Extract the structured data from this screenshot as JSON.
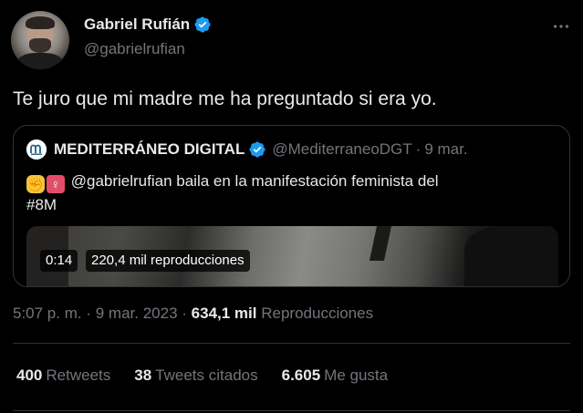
{
  "author": {
    "name": "Gabriel Rufián",
    "handle": "@gabrielrufian",
    "verified_color": "#1d9bf0"
  },
  "tweet": {
    "text": "Te juro que mi madre me ha preguntado si era yo."
  },
  "quoted": {
    "name": "MEDITERRÁNEO DIGITAL",
    "handle": "@MediterraneoDGT",
    "separator": "·",
    "date": "9 mar.",
    "emoji_1": "fist-emoji",
    "emoji_2": "female-sign-emoji",
    "text_line1": "@gabrielrufian baila en la manifestación feminista del",
    "text_line2": "#8M",
    "video_time": "0:14",
    "video_views": "220,4 mil reproducciones"
  },
  "meta": {
    "time": "5:07 p. m.",
    "sep1": "·",
    "date": "9 mar. 2023",
    "sep2": "·",
    "views_count": "634,1 mil",
    "views_label": "Reproducciones"
  },
  "stats": {
    "retweets_count": "400",
    "retweets_label": "Retweets",
    "quotes_count": "38",
    "quotes_label": "Tweets citados",
    "likes_count": "6.605",
    "likes_label": "Me gusta"
  },
  "icons": {
    "more": "more-icon",
    "verified": "verified-badge-icon",
    "quoted_logo": "mediterraneo-logo-icon"
  },
  "colors": {
    "background": "#000000",
    "primary_text": "#e7e9ea",
    "secondary_text": "#71767b",
    "border": "#2f3336",
    "accent": "#1d9bf0"
  }
}
